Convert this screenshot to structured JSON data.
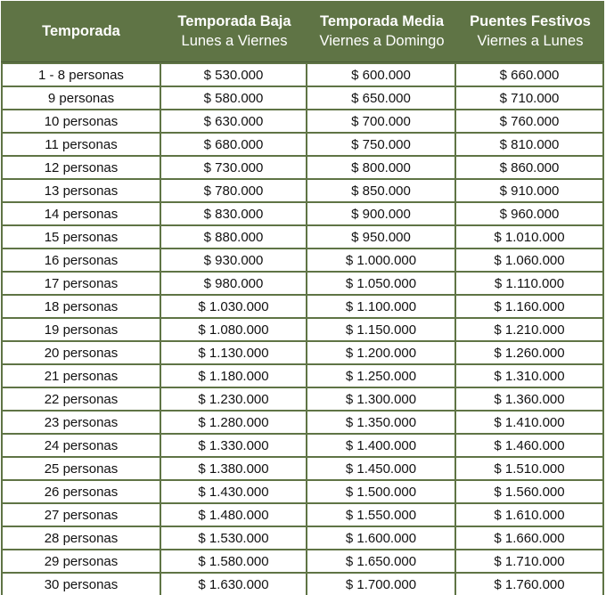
{
  "table": {
    "headers": [
      {
        "title": "Temporada",
        "subtitle": ""
      },
      {
        "title": "Temporada Baja",
        "subtitle": "Lunes a Viernes"
      },
      {
        "title": "Temporada Media",
        "subtitle": "Viernes a Domingo"
      },
      {
        "title": "Puentes Festivos",
        "subtitle": "Viernes a Lunes"
      }
    ],
    "rows": [
      [
        "1 - 8 personas",
        "$ 530.000",
        "$ 600.000",
        "$ 660.000"
      ],
      [
        "9 personas",
        "$ 580.000",
        "$ 650.000",
        "$ 710.000"
      ],
      [
        "10 personas",
        "$ 630.000",
        "$ 700.000",
        "$ 760.000"
      ],
      [
        "11 personas",
        "$ 680.000",
        "$ 750.000",
        "$ 810.000"
      ],
      [
        "12 personas",
        "$ 730.000",
        "$ 800.000",
        "$ 860.000"
      ],
      [
        "13 personas",
        "$ 780.000",
        "$ 850.000",
        "$ 910.000"
      ],
      [
        "14 personas",
        "$ 830.000",
        "$ 900.000",
        "$ 960.000"
      ],
      [
        "15 personas",
        "$ 880.000",
        "$ 950.000",
        "$ 1.010.000"
      ],
      [
        "16 personas",
        "$ 930.000",
        "$ 1.000.000",
        "$ 1.060.000"
      ],
      [
        "17 personas",
        "$ 980.000",
        "$ 1.050.000",
        "$ 1.110.000"
      ],
      [
        "18 personas",
        "$ 1.030.000",
        "$ 1.100.000",
        "$ 1.160.000"
      ],
      [
        "19 personas",
        "$ 1.080.000",
        "$ 1.150.000",
        "$ 1.210.000"
      ],
      [
        "20 personas",
        "$ 1.130.000",
        "$ 1.200.000",
        "$ 1.260.000"
      ],
      [
        "21 personas",
        "$ 1.180.000",
        "$ 1.250.000",
        "$ 1.310.000"
      ],
      [
        "22 personas",
        "$ 1.230.000",
        "$ 1.300.000",
        "$ 1.360.000"
      ],
      [
        "23 personas",
        "$ 1.280.000",
        "$ 1.350.000",
        "$ 1.410.000"
      ],
      [
        "24 personas",
        "$ 1.330.000",
        "$ 1.400.000",
        "$ 1.460.000"
      ],
      [
        "25 personas",
        "$ 1.380.000",
        "$ 1.450.000",
        "$ 1.510.000"
      ],
      [
        "26 personas",
        "$ 1.430.000",
        "$ 1.500.000",
        "$ 1.560.000"
      ],
      [
        "27 personas",
        "$ 1.480.000",
        "$ 1.550.000",
        "$ 1.610.000"
      ],
      [
        "28 personas",
        "$ 1.530.000",
        "$ 1.600.000",
        "$ 1.660.000"
      ],
      [
        "29 personas",
        "$ 1.580.000",
        "$ 1.650.000",
        "$ 1.710.000"
      ],
      [
        "30 personas",
        "$ 1.630.000",
        "$ 1.700.000",
        "$ 1.760.000"
      ]
    ]
  },
  "colors": {
    "header_bg": "#5f7445",
    "header_text": "#ffffff",
    "grid_line": "#5f7445",
    "cell_bg": "#ffffff",
    "cell_text": "#111111"
  }
}
